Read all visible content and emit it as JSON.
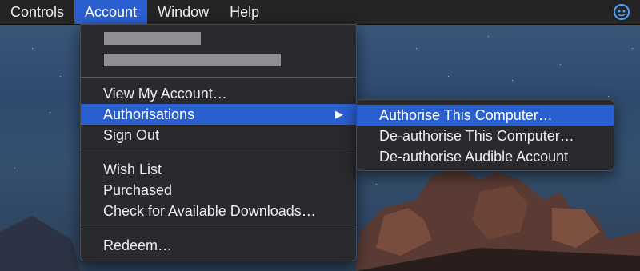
{
  "menubar": {
    "items": [
      {
        "label": "Controls"
      },
      {
        "label": "Account"
      },
      {
        "label": "Window"
      },
      {
        "label": "Help"
      }
    ]
  },
  "account_menu": {
    "items": [
      {
        "label": "View My Account…"
      },
      {
        "label": "Authorisations"
      },
      {
        "label": "Sign Out"
      },
      {
        "label": "Wish List"
      },
      {
        "label": "Purchased"
      },
      {
        "label": "Check for Available Downloads…"
      },
      {
        "label": "Redeem…"
      }
    ],
    "submenu_arrow": "▶"
  },
  "authorisations_submenu": {
    "items": [
      {
        "label": "Authorise This Computer…"
      },
      {
        "label": "De-authorise This Computer…"
      },
      {
        "label": "De-authorise Audible Account"
      }
    ]
  },
  "colors": {
    "highlight": "#2a5fcf",
    "menu_bg": "#28292c",
    "menubar_bg": "#242424",
    "status_icon": "#4aa3ff"
  },
  "icons": {
    "status": "cat-face-icon",
    "submenu": "chevron-right-icon"
  }
}
